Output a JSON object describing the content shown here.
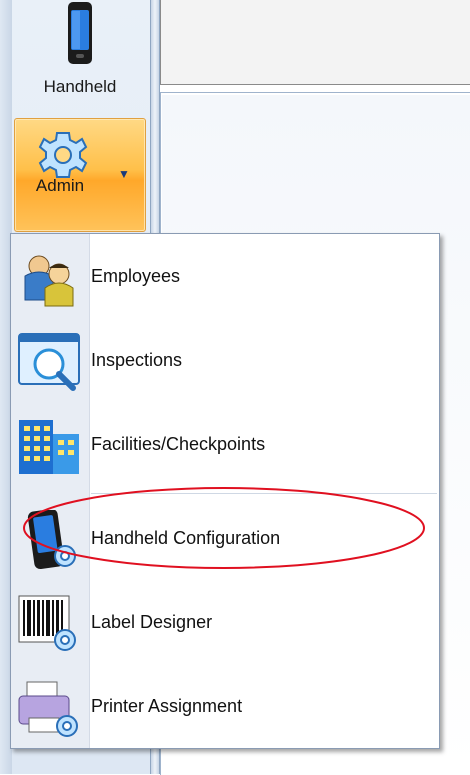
{
  "ribbon": {
    "handheld_label": "Handheld",
    "admin_label": "Admin",
    "admin_icon": "gear-icon",
    "handheld_icon": "mobile-phone-icon"
  },
  "menu": {
    "items": [
      {
        "label": "Employees",
        "icon": "employees-icon"
      },
      {
        "label": "Inspections",
        "icon": "inspections-icon"
      },
      {
        "label": "Facilities/Checkpoints",
        "icon": "facilities-icon"
      },
      {
        "label": "Handheld Configuration",
        "icon": "handheld-config-icon"
      },
      {
        "label": "Label Designer",
        "icon": "label-designer-icon"
      },
      {
        "label": "Printer Assignment",
        "icon": "printer-assignment-icon"
      }
    ]
  },
  "annotation": {
    "highlight_color": "#e01020"
  },
  "colors": {
    "admin_active": "#ffc04a",
    "menu_gutter": "#e8edf4"
  }
}
